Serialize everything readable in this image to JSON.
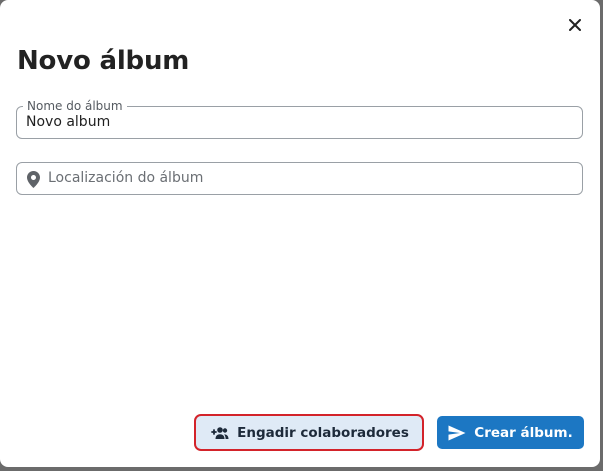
{
  "dialog": {
    "title": "Novo álbum",
    "close_icon": "close-icon"
  },
  "name_field": {
    "label": "Nome do álbum",
    "value": "Novo album"
  },
  "location_field": {
    "placeholder": "Localización do álbum",
    "icon": "map-pin-icon"
  },
  "actions": {
    "add_collaborators_label": "Engadir colaboradores",
    "add_collaborators_icon": "add-people-icon",
    "create_label": "Crear álbum.",
    "create_icon": "send-icon"
  },
  "colors": {
    "primary": "#1c77c3",
    "secondary_bg": "#dfeaf6",
    "highlight_outline": "#d3232a"
  }
}
